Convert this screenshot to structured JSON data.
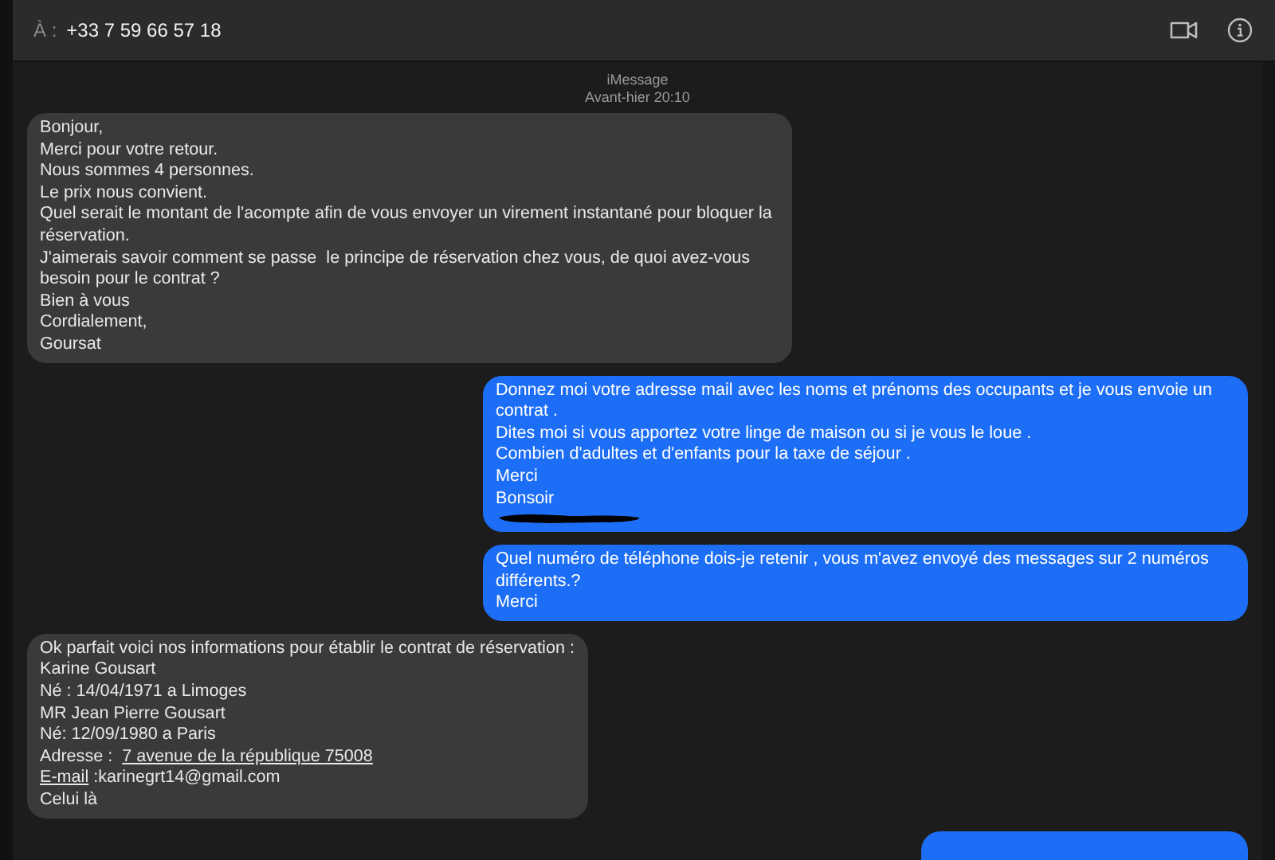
{
  "header": {
    "to_label": "À :",
    "recipient": "+33 7 59 66 57 18"
  },
  "timestamp": {
    "service": "iMessage",
    "time": "Avant-hier 20:10"
  },
  "messages": [
    {
      "kind": "received",
      "redacted": false,
      "lines": [
        "Bonjour,",
        "Merci pour votre retour.",
        "Nous sommes 4 personnes.",
        "Le prix nous convient.",
        "Quel serait le montant de l'acompte afin de vous envoyer un virement instantané pour bloquer la réservation.",
        "J'aimerais savoir comment se passe  le principe de réservation chez vous, de quoi avez-vous besoin pour le contrat ?",
        "Bien à vous",
        "Cordialement,",
        "Goursat"
      ]
    },
    {
      "kind": "sent",
      "redacted": true,
      "lines": [
        "Donnez moi votre adresse mail avec les noms et prénoms des occupants et je vous envoie un contrat .",
        "Dites moi si vous apportez votre linge de maison ou si je vous le loue .",
        "Combien d'adultes et d'enfants pour la taxe de séjour .",
        "Merci",
        "Bonsoir"
      ]
    },
    {
      "kind": "sent",
      "redacted": false,
      "lines": [
        "Quel numéro de téléphone dois-je retenir , vous m'avez envoyé des messages sur 2 numéros différents.?",
        "Merci"
      ]
    },
    {
      "kind": "received",
      "redacted": false,
      "lines": [
        "Ok parfait voici nos informations pour établir le contrat de réservation :",
        "Karine Gousart",
        "Né : 14/04/1971 a Limoges",
        "MR Jean Pierre Gousart",
        "Né: 12/09/1980 a Paris",
        [
          {
            "text": "Adresse :  ",
            "link": false
          },
          {
            "text": "7 avenue de la république 75008",
            "link": true
          }
        ],
        [
          {
            "text": "E-mail",
            "link": true
          },
          {
            "text": " :karinegrt14@gmail.com",
            "link": false
          }
        ],
        "Celui là"
      ]
    },
    {
      "kind": "sent",
      "redacted": false
    }
  ]
}
